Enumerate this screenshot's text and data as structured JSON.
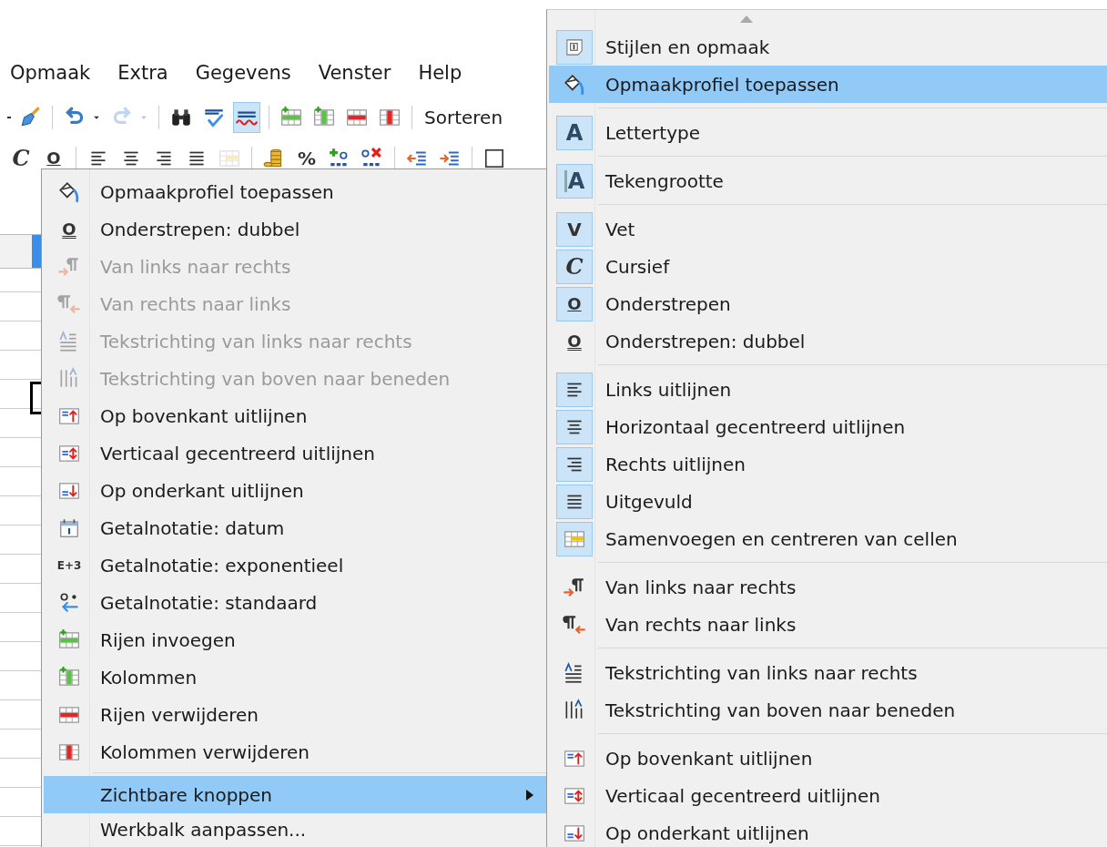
{
  "menubar": [
    {
      "label": "Opmaak"
    },
    {
      "label": "Extra"
    },
    {
      "label": "Gegevens"
    },
    {
      "label": "Venster"
    },
    {
      "label": "Help"
    }
  ],
  "toolbar_1": {
    "buttons": [
      {
        "pressed": false,
        "disabled": false
      },
      {
        "pressed": false,
        "disabled": false
      },
      {
        "pressed": false,
        "disabled": true
      },
      {
        "pressed": false,
        "disabled": false
      },
      {
        "pressed": false,
        "disabled": false
      },
      {
        "pressed": true,
        "disabled": false
      },
      {
        "pressed": false,
        "disabled": false
      },
      {
        "pressed": false,
        "disabled": false
      },
      {
        "pressed": false,
        "disabled": false
      },
      {
        "pressed": false,
        "disabled": false
      }
    ],
    "sort_label": "Sorteren"
  },
  "toolbar_2": {
    "buttons": [
      {
        "icon_text": "C",
        "disabled": false
      },
      {
        "icon_text": "O",
        "disabled": false
      },
      {
        "disabled": false
      },
      {
        "disabled": false
      },
      {
        "disabled": false
      },
      {
        "disabled": false
      },
      {
        "disabled": true
      },
      {
        "disabled": false
      },
      {
        "icon_text": "%",
        "disabled": false
      },
      {
        "disabled": false
      },
      {
        "disabled": false
      },
      {
        "disabled": false
      },
      {
        "disabled": false
      },
      {
        "disabled": false
      }
    ]
  },
  "context_menu": {
    "groups": [
      {
        "items": [
          {
            "label": "Opmaakprofiel toepassen",
            "disabled": false,
            "selected": false
          },
          {
            "label": "Onderstrepen: dubbel",
            "icon_text": "O",
            "disabled": false,
            "selected": false
          },
          {
            "label": "Van links naar rechts",
            "disabled": true,
            "selected": false
          },
          {
            "label": "Van rechts naar links",
            "disabled": true,
            "selected": false
          },
          {
            "label": "Tekstrichting van links naar rechts",
            "disabled": true,
            "selected": false
          },
          {
            "label": "Tekstrichting van boven naar beneden",
            "disabled": true,
            "selected": false
          },
          {
            "label": "Op bovenkant uitlijnen",
            "disabled": false,
            "selected": false
          },
          {
            "label": "Verticaal gecentreerd uitlijnen",
            "disabled": false,
            "selected": false
          },
          {
            "label": "Op onderkant uitlijnen",
            "disabled": false,
            "selected": false
          },
          {
            "label": "Getalnotatie: datum",
            "disabled": false,
            "selected": false
          },
          {
            "label": "Getalnotatie: exponentieel",
            "icon_text": "E+3",
            "disabled": false,
            "selected": false
          },
          {
            "label": "Getalnotatie: standaard",
            "disabled": false,
            "selected": false
          },
          {
            "label": "Rijen invoegen",
            "disabled": false,
            "selected": false
          },
          {
            "label": "Kolommen",
            "disabled": false,
            "selected": false
          },
          {
            "label": "Rijen verwijderen",
            "disabled": false,
            "selected": false
          },
          {
            "label": "Kolommen verwijderen",
            "disabled": false,
            "selected": false
          }
        ]
      },
      {
        "items": [
          {
            "label": "Zichtbare knoppen",
            "disabled": false,
            "selected": true,
            "submenu": true
          },
          {
            "label": "Werkbalk aanpassen...",
            "disabled": false,
            "selected": false,
            "submenu": false
          }
        ]
      }
    ]
  },
  "submenu": {
    "groups": [
      {
        "items": [
          {
            "label": "Stijlen en opmaak",
            "checked": true,
            "selected": false
          },
          {
            "label": "Opmaakprofiel toepassen",
            "checked": false,
            "selected": true
          }
        ]
      },
      {
        "items": [
          {
            "label": "Lettertype",
            "icon_text": "A",
            "checked": true,
            "selected": false
          }
        ]
      },
      {
        "items": [
          {
            "label": "Tekengrootte",
            "icon_text": "A",
            "checked": true,
            "selected": false
          }
        ]
      },
      {
        "items": [
          {
            "label": "Vet",
            "icon_text": "V",
            "checked": true,
            "selected": false
          },
          {
            "label": "Cursief",
            "icon_text": "C",
            "checked": true,
            "selected": false
          },
          {
            "label": "Onderstrepen",
            "icon_text": "O",
            "checked": true,
            "selected": false
          },
          {
            "label": "Onderstrepen: dubbel",
            "icon_text": "O",
            "checked": false,
            "selected": false
          }
        ]
      },
      {
        "items": [
          {
            "label": "Links uitlijnen",
            "checked": true,
            "selected": false
          },
          {
            "label": "Horizontaal gecentreerd uitlijnen",
            "checked": true,
            "selected": false
          },
          {
            "label": "Rechts uitlijnen",
            "checked": true,
            "selected": false
          },
          {
            "label": "Uitgevuld",
            "checked": true,
            "selected": false
          },
          {
            "label": "Samenvoegen en centreren van cellen",
            "checked": true,
            "selected": false
          }
        ]
      },
      {
        "items": [
          {
            "label": "Van links naar rechts",
            "checked": false,
            "selected": false
          },
          {
            "label": "Van rechts naar links",
            "checked": false,
            "selected": false
          }
        ]
      },
      {
        "items": [
          {
            "label": "Tekstrichting van links naar rechts",
            "checked": false,
            "selected": false
          },
          {
            "label": "Tekstrichting van boven naar beneden",
            "checked": false,
            "selected": false
          }
        ]
      },
      {
        "items": [
          {
            "label": "Op bovenkant uitlijnen",
            "checked": false,
            "selected": false
          },
          {
            "label": "Verticaal gecentreerd uitlijnen",
            "checked": false,
            "selected": false
          },
          {
            "label": "Op onderkant uitlijnen",
            "checked": false,
            "selected": false
          }
        ]
      }
    ]
  }
}
